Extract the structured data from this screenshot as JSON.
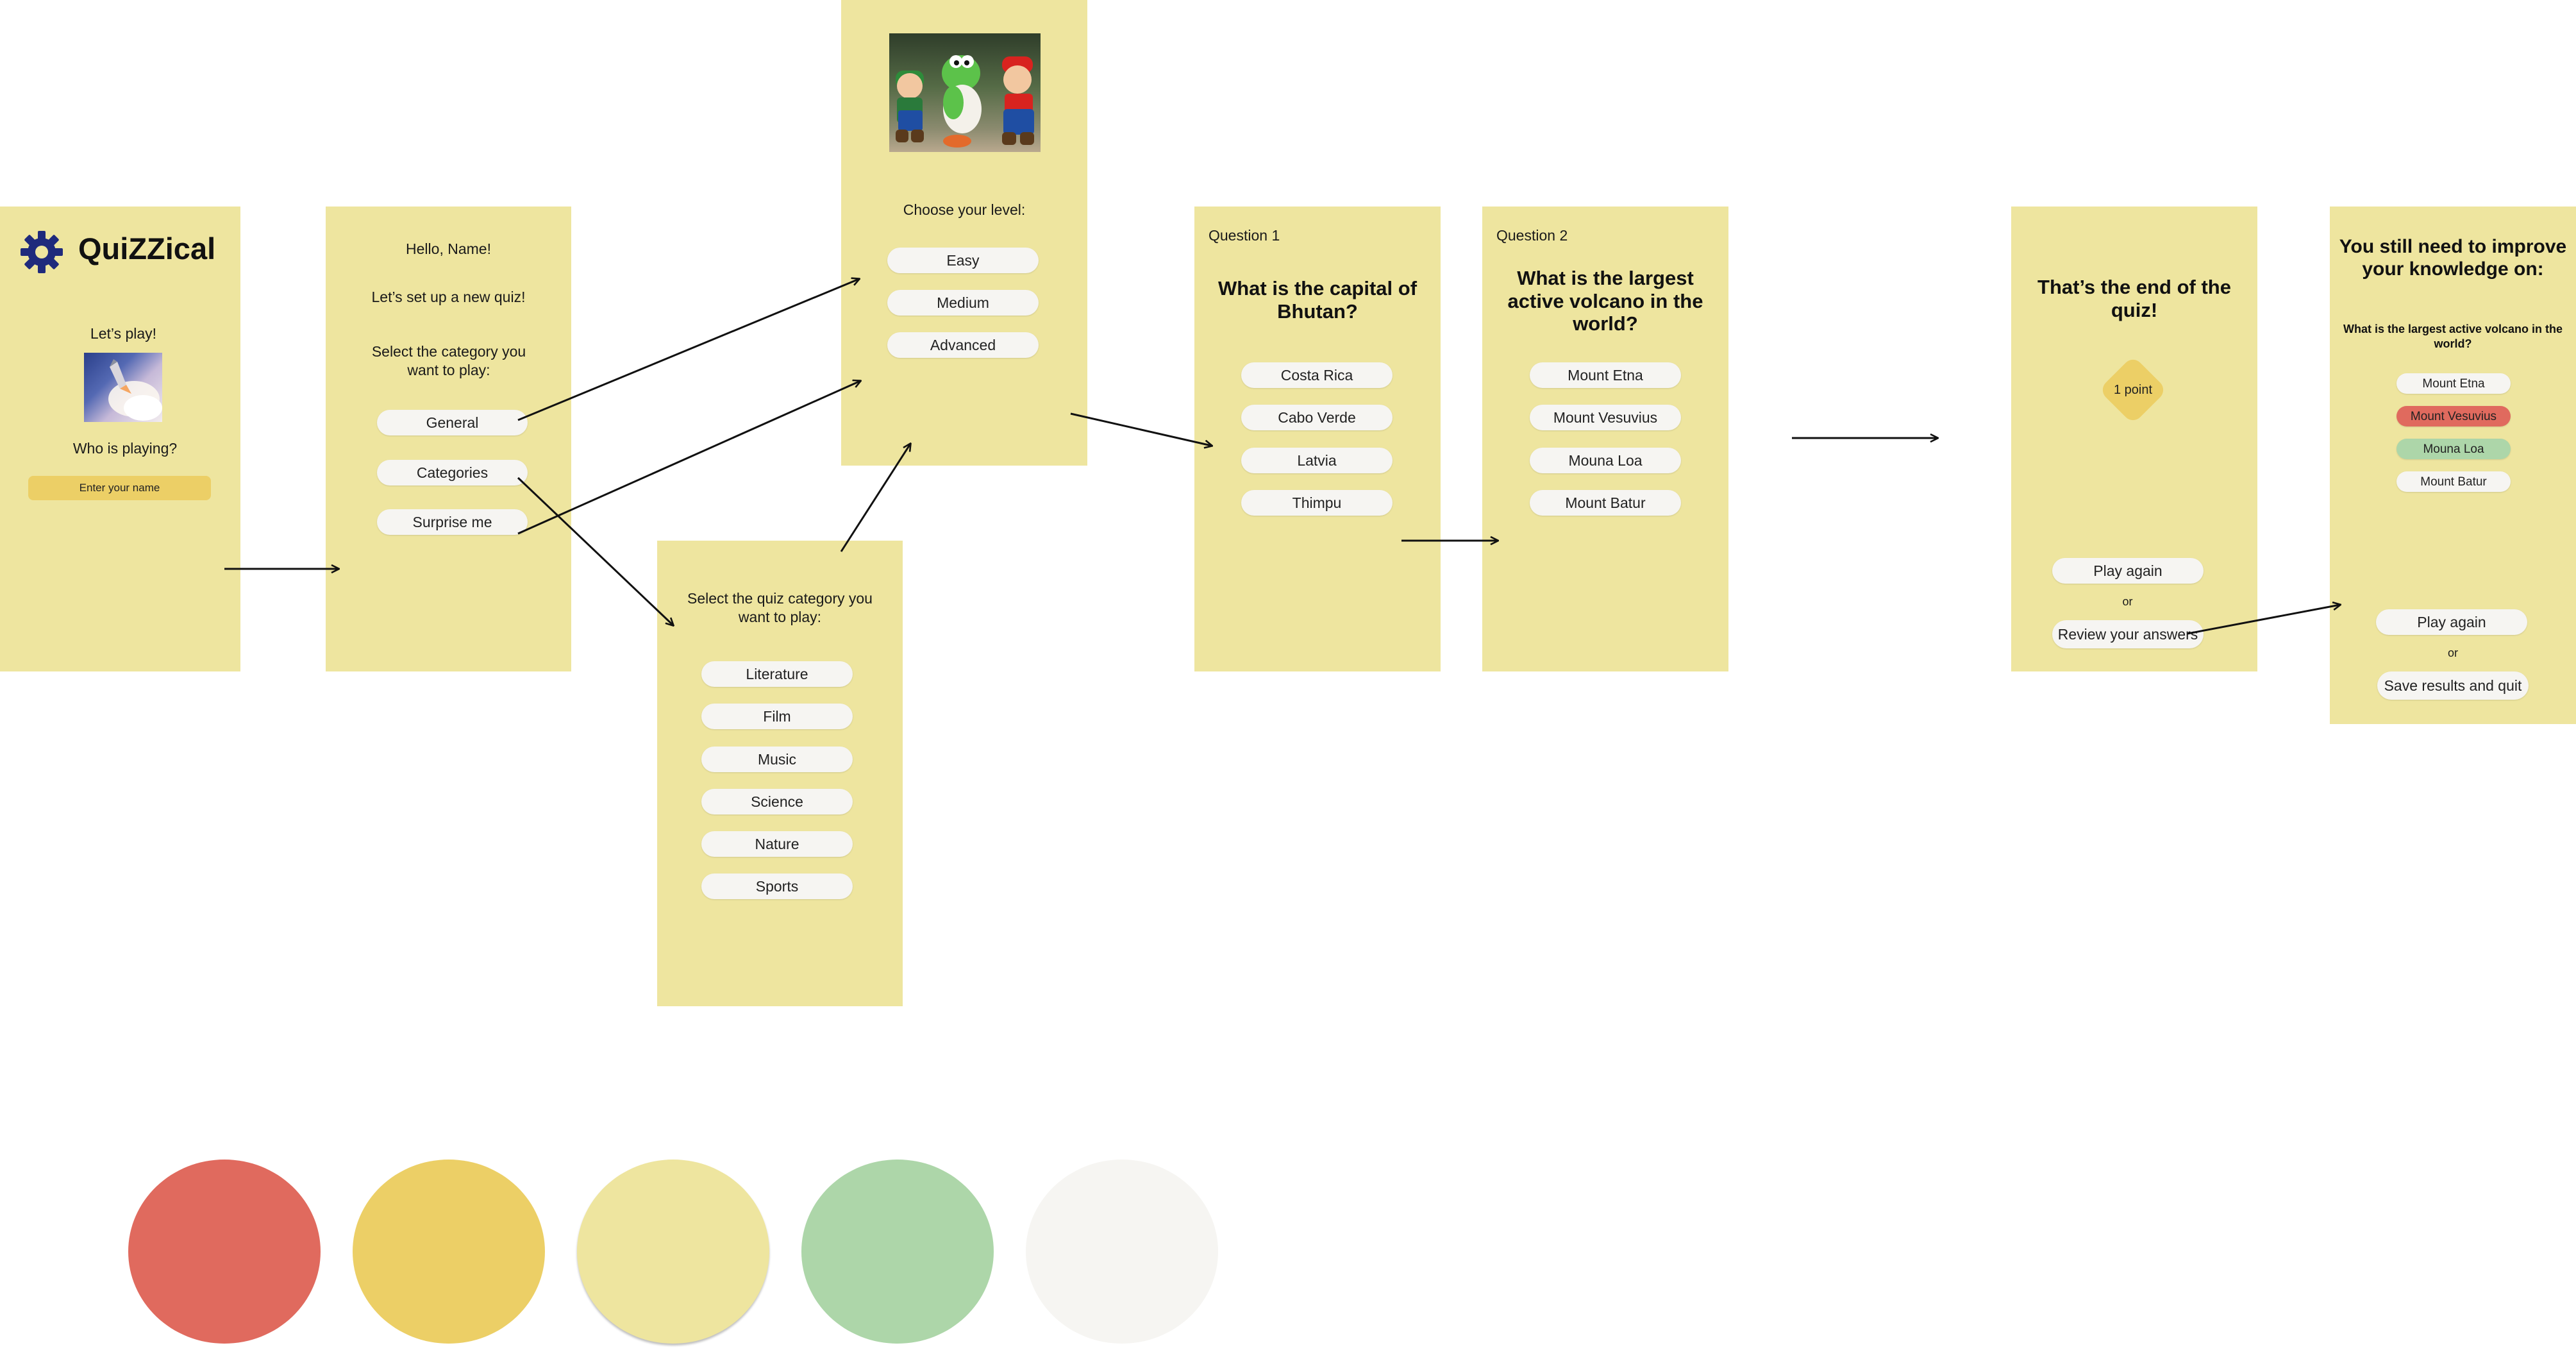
{
  "screen1": {
    "app_name": "QuiZZical",
    "lets_play": "Let’s play!",
    "who_playing": "Who is playing?",
    "name_placeholder": "Enter your name"
  },
  "screen2": {
    "greeting": "Hello, Name!",
    "setup": "Let’s set up a new quiz!",
    "select_category": "Select the category you want to play:",
    "options": [
      "General",
      "Categories",
      "Surprise me"
    ]
  },
  "level_screen": {
    "choose_level": "Choose your level:",
    "levels": [
      "Easy",
      "Medium",
      "Advanced"
    ]
  },
  "category_screen": {
    "title": "Select the quiz category you want to play:",
    "categories": [
      "Literature",
      "Film",
      "Music",
      "Science",
      "Nature",
      "Sports"
    ]
  },
  "question1": {
    "label": "Question 1",
    "question": "What is the capital of Bhutan?",
    "answers": [
      "Costa Rica",
      "Cabo Verde",
      "Latvia",
      "Thimpu"
    ]
  },
  "question2": {
    "label": "Question 2",
    "question": "What is the largest active volcano in the world?",
    "answers": [
      "Mount Etna",
      "Mount Vesuvius",
      "Mouna Loa",
      "Mount Batur"
    ]
  },
  "end_screen": {
    "title": "That’s the end of the quiz!",
    "score": "1 point",
    "play_again": "Play again",
    "or": "or",
    "review": "Review your answers"
  },
  "review_screen": {
    "title": "You still need to improve your knowledge on:",
    "question": "What is the largest active volcano in the world?",
    "answers": [
      "Mount Etna",
      "Mount Vesuvius",
      "Mouna Loa",
      "Mount Batur"
    ],
    "play_again": "Play again",
    "or": "or",
    "save_quit": "Save results and quit"
  },
  "colors": {
    "screen_bg": "#eee59f",
    "palette": [
      "#e06a5e",
      "#eccf66",
      "#eee59f",
      "#add6a9",
      "#f6f5f2"
    ],
    "accent_dark": "#1f2a7c"
  }
}
